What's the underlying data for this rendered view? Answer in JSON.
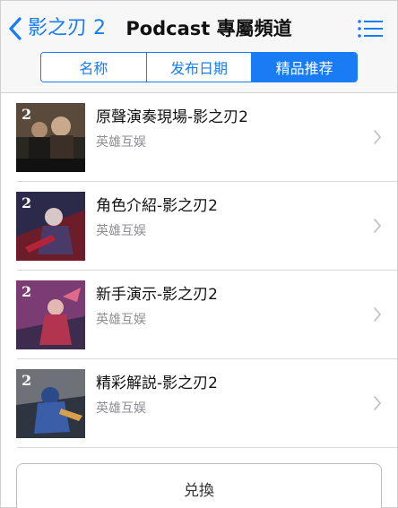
{
  "nav": {
    "back_label": "影之刃 2",
    "title": "Podcast 專屬頻道"
  },
  "tabs": [
    {
      "label": "名称",
      "active": false
    },
    {
      "label": "发布日期",
      "active": false
    },
    {
      "label": "精品推荐",
      "active": true
    }
  ],
  "episodes": [
    {
      "title": "原聲演奏現場-影之刃2",
      "author": "英雄互娱",
      "thumb_icon": "episode-artwork-icon"
    },
    {
      "title": "角色介紹-影之刃2",
      "author": "英雄互娱",
      "thumb_icon": "episode-artwork-icon"
    },
    {
      "title": "新手演示-影之刃2",
      "author": "英雄互娱",
      "thumb_icon": "episode-artwork-icon"
    },
    {
      "title": "精彩解説-影之刃2",
      "author": "英雄互娱",
      "thumb_icon": "episode-artwork-icon"
    }
  ],
  "redeem_label": "兑換",
  "colors": {
    "accent": "#1a7cf5",
    "secondary_text": "#8e8e93"
  }
}
